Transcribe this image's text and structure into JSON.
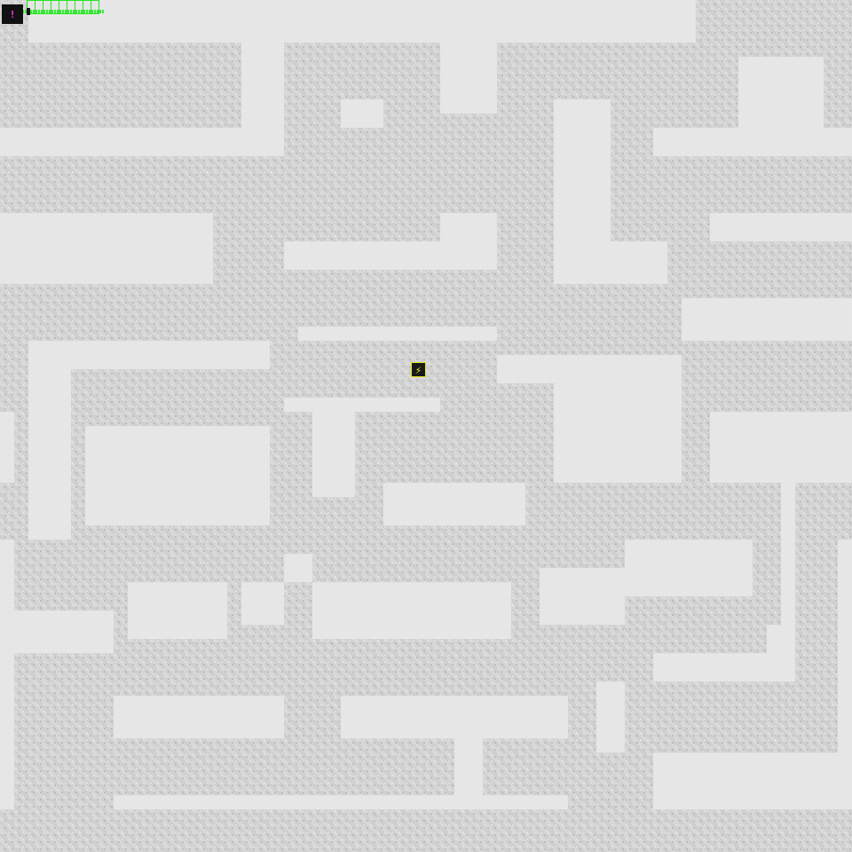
{
  "hud": {
    "portrait_glyph": "!",
    "portrait_color": "#ff34ff",
    "slot_count": 9,
    "slot_color": "#22e622"
  },
  "player": {
    "glyph": "⚡",
    "color": "#f2f220",
    "icon": "player-character-icon"
  },
  "tiles": {
    "wall_color": "#cfcfcf",
    "floor_color": "#e7e7e7"
  }
}
